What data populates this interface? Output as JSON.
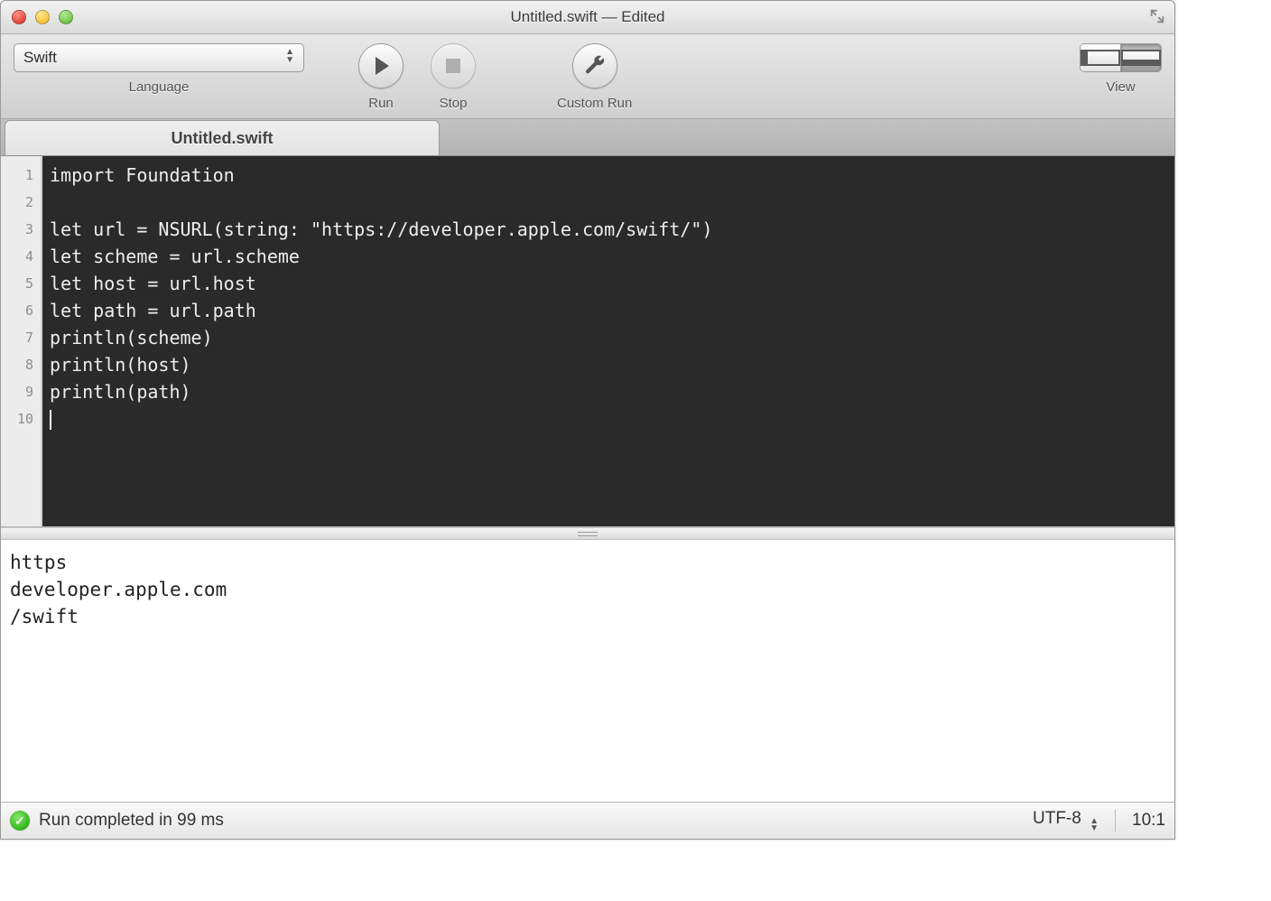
{
  "titlebar": {
    "title": "Untitled.swift — Edited"
  },
  "toolbar": {
    "language": {
      "label": "Language",
      "value": "Swift"
    },
    "run": {
      "label": "Run"
    },
    "stop": {
      "label": "Stop"
    },
    "custom": {
      "label": "Custom Run"
    },
    "view": {
      "label": "View"
    }
  },
  "tabs": [
    {
      "label": "Untitled.swift"
    }
  ],
  "editor": {
    "line_numbers": [
      "1",
      "2",
      "3",
      "4",
      "5",
      "6",
      "7",
      "8",
      "9",
      "10"
    ],
    "lines": [
      "import Foundation",
      "",
      "let url = NSURL(string: \"https://developer.apple.com/swift/\")",
      "let scheme = url.scheme",
      "let host = url.host",
      "let path = url.path",
      "println(scheme)",
      "println(host)",
      "println(path)",
      ""
    ]
  },
  "output": {
    "lines": [
      "https",
      "developer.apple.com",
      "/swift"
    ]
  },
  "status": {
    "message": "Run completed in 99 ms",
    "encoding": "UTF-8",
    "cursor": "10:1"
  }
}
